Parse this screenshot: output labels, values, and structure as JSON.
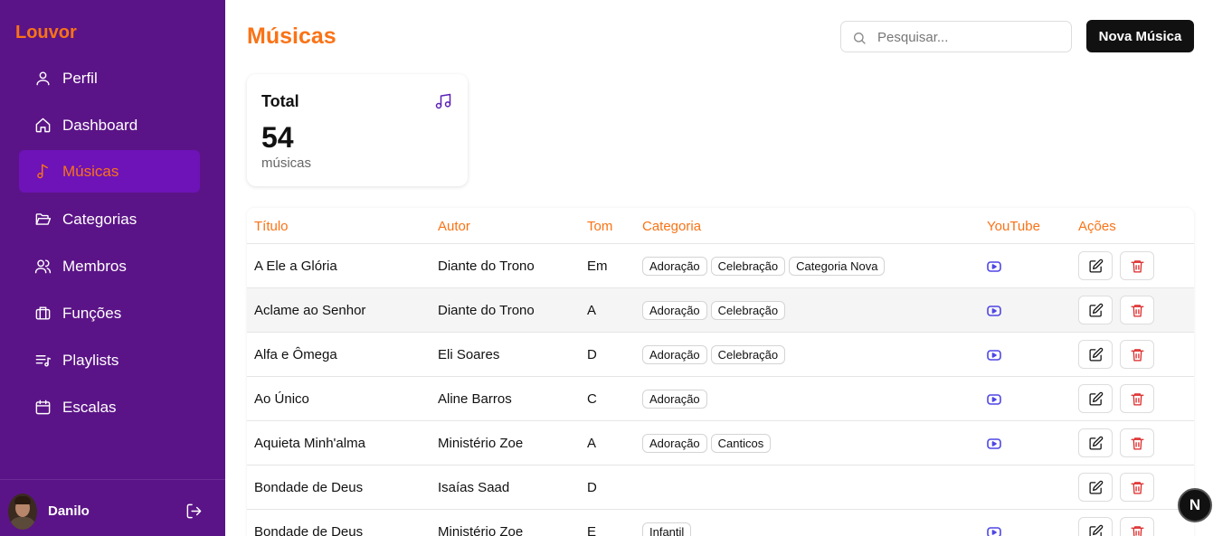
{
  "app": {
    "brand": "Louvor",
    "accent": "#f97316",
    "sidebar_bg": "#5b1487"
  },
  "sidebar": {
    "items": [
      {
        "label": "Perfil",
        "icon": "user-icon",
        "active": false
      },
      {
        "label": "Dashboard",
        "icon": "home-icon",
        "active": false
      },
      {
        "label": "Músicas",
        "icon": "music-note-icon",
        "active": true
      },
      {
        "label": "Categorias",
        "icon": "folder-open-icon",
        "active": false
      },
      {
        "label": "Membros",
        "icon": "users-icon",
        "active": false
      },
      {
        "label": "Funções",
        "icon": "briefcase-icon",
        "active": false
      },
      {
        "label": "Playlists",
        "icon": "list-music-icon",
        "active": false
      },
      {
        "label": "Escalas",
        "icon": "calendar-icon",
        "active": false
      }
    ],
    "user": {
      "name": "Danilo"
    }
  },
  "header": {
    "title": "Músicas",
    "search_placeholder": "Pesquisar...",
    "new_button": "Nova Música"
  },
  "stats": {
    "title": "Total",
    "value": "54",
    "unit": "músicas"
  },
  "table": {
    "headers": {
      "titulo": "Título",
      "autor": "Autor",
      "tom": "Tom",
      "categoria": "Categoria",
      "youtube": "YouTube",
      "acoes": "Ações"
    },
    "rows": [
      {
        "titulo": "A Ele a Glória",
        "autor": "Diante do Trono",
        "tom": "Em",
        "categorias": [
          "Adoração",
          "Celebração",
          "Categoria Nova"
        ],
        "youtube": true
      },
      {
        "titulo": "Aclame ao Senhor",
        "autor": "Diante do Trono",
        "tom": "A",
        "categorias": [
          "Adoração",
          "Celebração"
        ],
        "youtube": true
      },
      {
        "titulo": "Alfa e Ômega",
        "autor": "Eli Soares",
        "tom": "D",
        "categorias": [
          "Adoração",
          "Celebração"
        ],
        "youtube": true
      },
      {
        "titulo": "Ao Único",
        "autor": "Aline Barros",
        "tom": "C",
        "categorias": [
          "Adoração"
        ],
        "youtube": true
      },
      {
        "titulo": "Aquieta Minh'alma",
        "autor": "Ministério Zoe",
        "tom": "A",
        "categorias": [
          "Adoração",
          "Canticos"
        ],
        "youtube": true
      },
      {
        "titulo": "Bondade de Deus",
        "autor": "Isaías Saad",
        "tom": "D",
        "categorias": [],
        "youtube": false
      },
      {
        "titulo": "Bondade de Deus",
        "autor": "Ministério Zoe",
        "tom": "E",
        "categorias": [
          "Infantil"
        ],
        "youtube": true
      }
    ]
  },
  "badge": {
    "label": "N"
  }
}
